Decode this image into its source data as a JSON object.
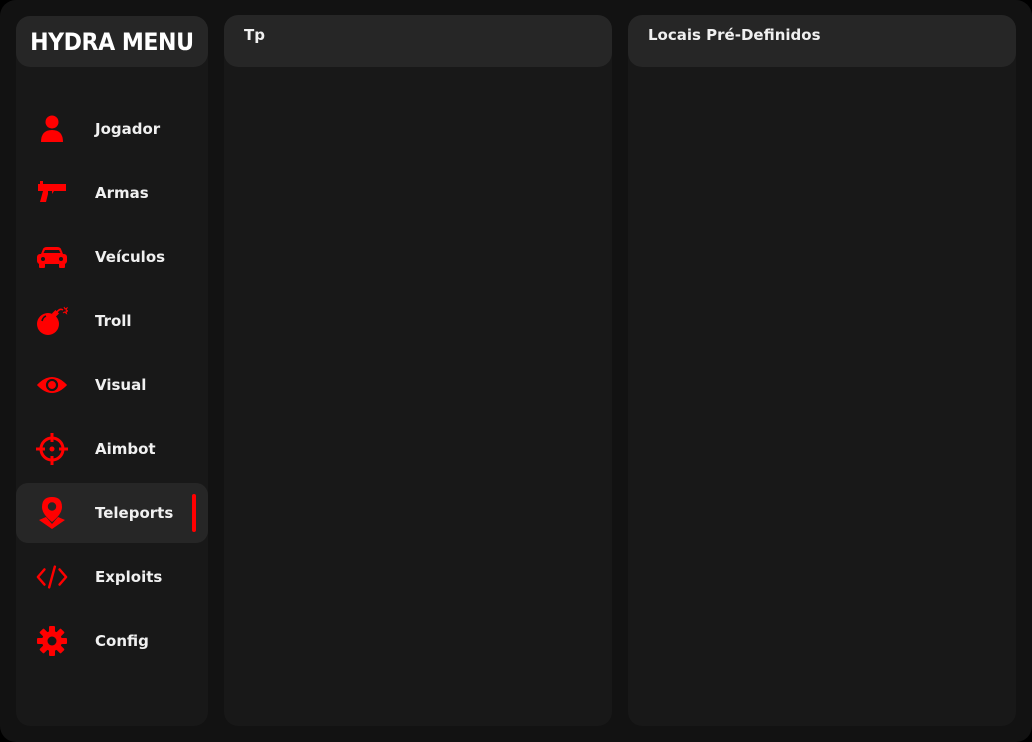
{
  "app": {
    "title": "HYDRA MENU",
    "accent_color": "#ff0000"
  },
  "sidebar": {
    "items": [
      {
        "label": "Jogador",
        "icon": "user-icon",
        "active": false
      },
      {
        "label": "Armas",
        "icon": "gun-icon",
        "active": false
      },
      {
        "label": "Veículos",
        "icon": "car-icon",
        "active": false
      },
      {
        "label": "Troll",
        "icon": "bomb-icon",
        "active": false
      },
      {
        "label": "Visual",
        "icon": "eye-icon",
        "active": false
      },
      {
        "label": "Aimbot",
        "icon": "crosshair-icon",
        "active": false
      },
      {
        "label": "Teleports",
        "icon": "map-pin-icon",
        "active": true
      },
      {
        "label": "Exploits",
        "icon": "code-icon",
        "active": false
      },
      {
        "label": "Config",
        "icon": "gear-icon",
        "active": false
      }
    ]
  },
  "panels": {
    "left": {
      "title": "Tp"
    },
    "right": {
      "title": "Locais Pré-Definidos"
    }
  }
}
